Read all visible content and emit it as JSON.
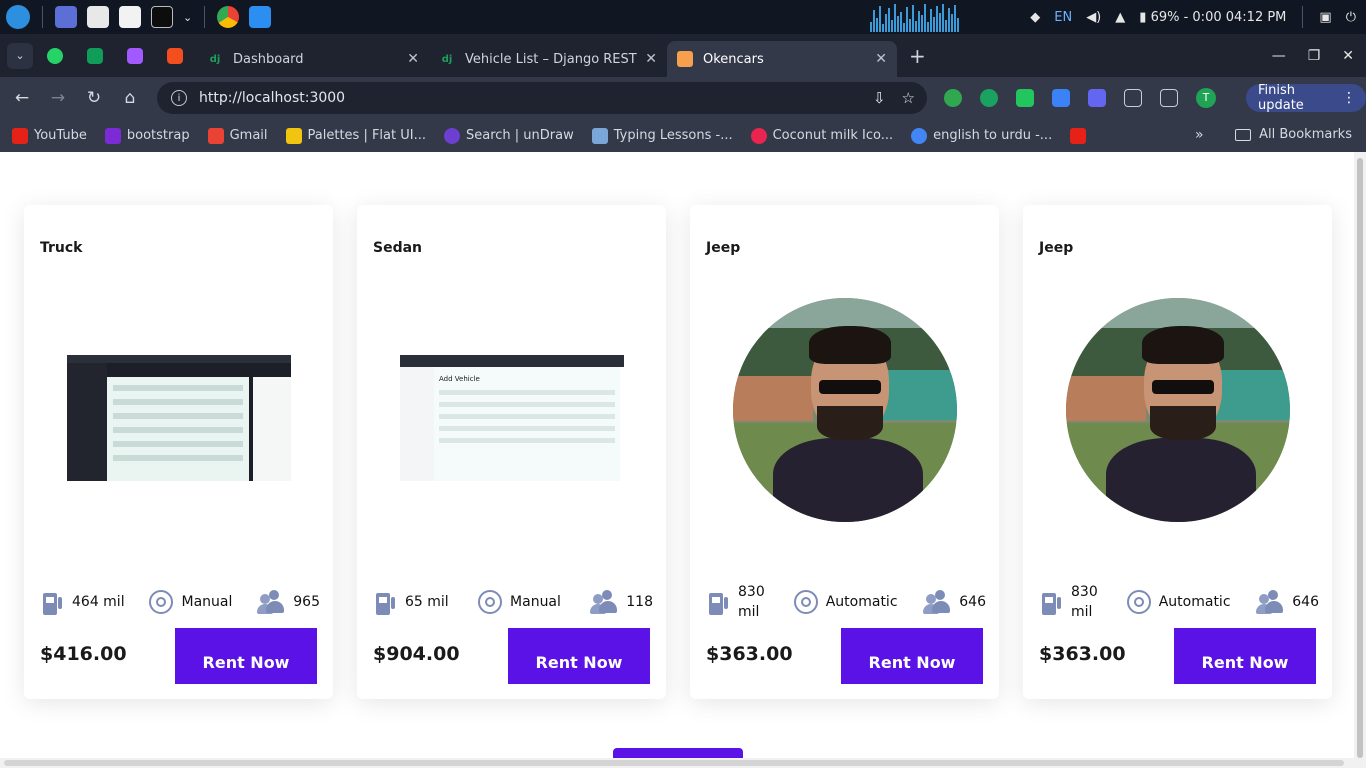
{
  "system": {
    "language": "EN",
    "battery": "69% - 0:00",
    "time": "04:12 PM"
  },
  "tabs": [
    {
      "favicon": "dj",
      "title": "Dashboard"
    },
    {
      "favicon": "dj",
      "title": "Vehicle List – Django REST fr"
    },
    {
      "favicon": "",
      "title": "Okencars"
    }
  ],
  "address": {
    "url": "http://localhost:3000"
  },
  "profile_initial": "T",
  "finish_update_label": "Finish update",
  "bookmarks": [
    {
      "label": "YouTube",
      "color": "#e62117"
    },
    {
      "label": "bootstrap",
      "color": "#7b2bd6"
    },
    {
      "label": "Gmail",
      "color": "#ea4335"
    },
    {
      "label": "Palettes | Flat UI...",
      "color": "#f1c40f"
    },
    {
      "label": "Search | unDraw",
      "color": "#6c3fd1"
    },
    {
      "label": "Typing Lessons -...",
      "color": "#7aa7d8"
    },
    {
      "label": "Coconut milk Ico...",
      "color": "#e8244f"
    },
    {
      "label": "english to urdu -...",
      "color": "#4285f4"
    }
  ],
  "all_bookmarks_label": "All Bookmarks",
  "more_bookmarks": "»",
  "cards": [
    {
      "name": "Truck",
      "mileage": "464 mil",
      "transmission": "Manual",
      "seats": "965",
      "price": "$416.00",
      "cta": "Rent Now",
      "image": "screenshot-dashboard"
    },
    {
      "name": "Sedan",
      "mileage": "65 mil",
      "transmission": "Manual",
      "seats": "118",
      "price": "$904.00",
      "cta": "Rent Now",
      "image": "screenshot-add-vehicle",
      "image_heading": "Add Vehicle"
    },
    {
      "name": "Jeep",
      "mileage": "830 mil",
      "transmission": "Automatic",
      "seats": "646",
      "price": "$363.00",
      "cta": "Rent Now",
      "image": "person-photo"
    },
    {
      "name": "Jeep",
      "mileage": "830 mil",
      "transmission": "Automatic",
      "seats": "646",
      "price": "$363.00",
      "cta": "Rent Now",
      "image": "person-photo"
    }
  ],
  "colors": {
    "accent": "#5a12e6",
    "icon": "#7d8bb7",
    "browser_dark": "#1f2330",
    "browser_toolbar": "#34394a"
  },
  "icons": {
    "mileage": "fuel-pump-icon",
    "transmission": "steering-wheel-icon",
    "seats": "users-icon"
  }
}
